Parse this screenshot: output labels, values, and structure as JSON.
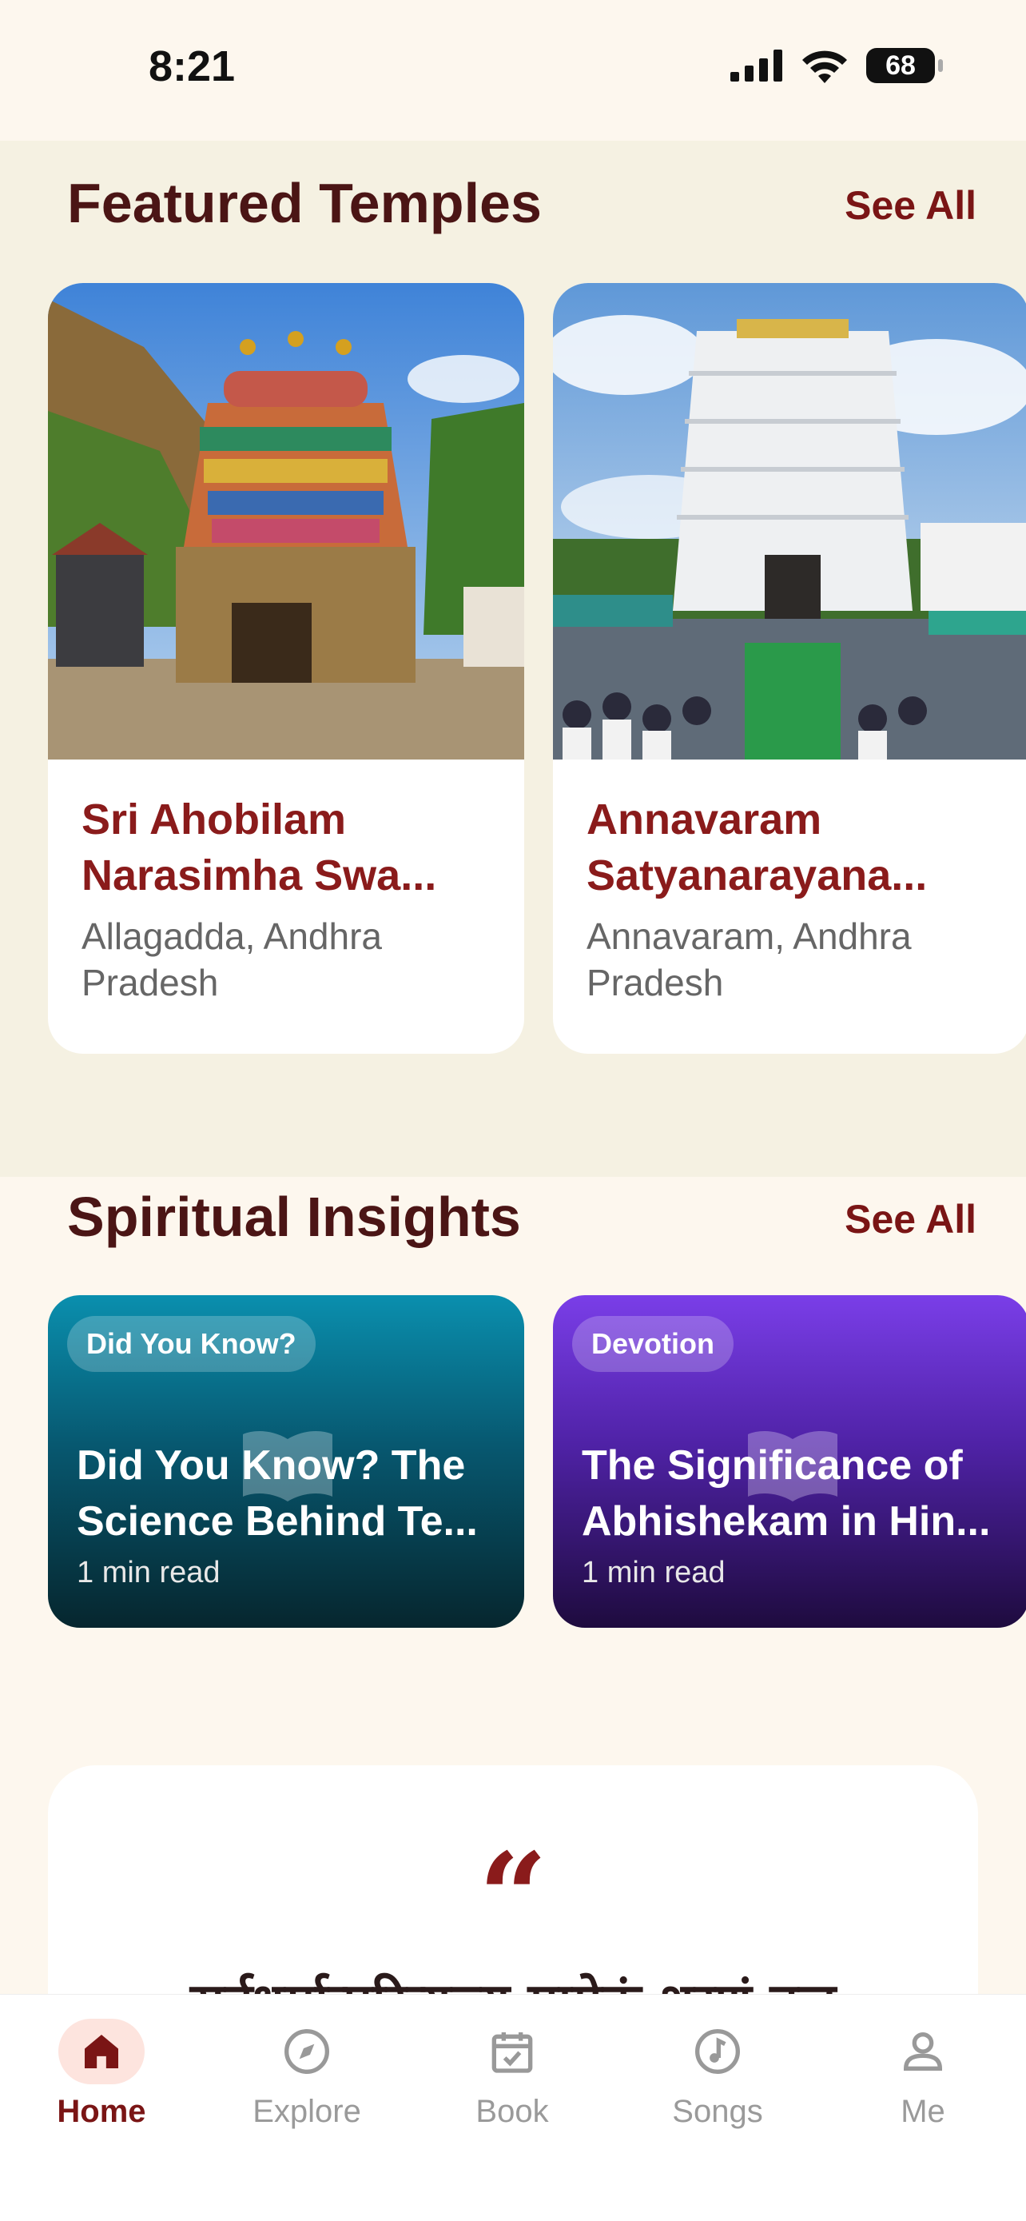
{
  "status_bar": {
    "time": "8:21",
    "battery": "68"
  },
  "featured": {
    "title": "Featured Temples",
    "see_all": "See All",
    "temples": [
      {
        "name": "Sri Ahobilam Narasimha Swa...",
        "location": "Allagadda, Andhra Pradesh"
      },
      {
        "name": "Annavaram Satyanarayana...",
        "location": "Annavaram, Andhra Pradesh"
      }
    ]
  },
  "insights": {
    "title": "Spiritual Insights",
    "see_all": "See All",
    "items": [
      {
        "tag": "Did You Know?",
        "title": "Did You Know? The Science Behind Te...",
        "meta": "1 min read",
        "color": "#0a8fae"
      },
      {
        "tag": "Devotion",
        "title": "The Significance of Abhishekam in Hin...",
        "meta": "1 min read",
        "color": "#7a3ee8"
      }
    ]
  },
  "quote": {
    "mark": "“",
    "text": "सर्वधर्मान्परित्यज्य मामेकं शरणं व्रज"
  },
  "tabs": [
    {
      "label": "Home",
      "icon": "home-icon",
      "active": true
    },
    {
      "label": "Explore",
      "icon": "compass-icon",
      "active": false
    },
    {
      "label": "Book",
      "icon": "calendar-check-icon",
      "active": false
    },
    {
      "label": "Songs",
      "icon": "music-icon",
      "active": false
    },
    {
      "label": "Me",
      "icon": "person-icon",
      "active": false
    }
  ],
  "colors": {
    "accent": "#7a1515",
    "background": "#fdf7ee",
    "featured_bg": "#f5f1e2"
  }
}
